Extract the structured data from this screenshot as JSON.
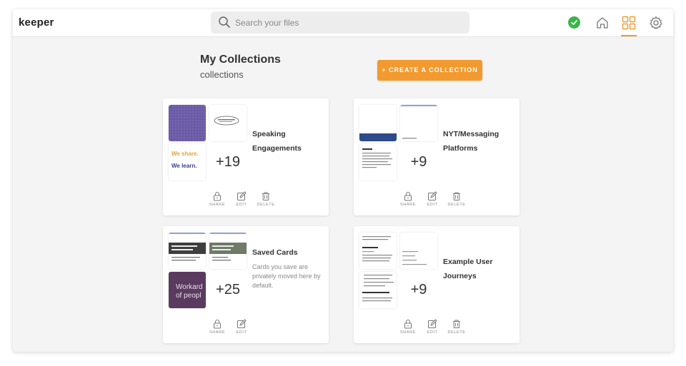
{
  "app": {
    "logo": "keeper"
  },
  "search": {
    "placeholder": "Search your files"
  },
  "header": {
    "title": "My Collections",
    "subtitle": "collections",
    "create_label": "+ CREATE A COLLECTION"
  },
  "colors": {
    "accent": "#f29a2e",
    "success": "#3bb44a",
    "background": "#f4f4f4"
  },
  "actions": {
    "share": "SHARE",
    "edit": "EDIT",
    "delete": "DELETE"
  },
  "collections": [
    {
      "title_line1": "Speaking",
      "title_line2": "Engagements",
      "count": "+19",
      "thumb_text_1": "We share.",
      "thumb_text_2": "We learn."
    },
    {
      "title_line1": "NYT/Messaging",
      "title_line2": "Platforms",
      "count": "+9"
    },
    {
      "title_line1": "Saved Cards",
      "title_line2": "",
      "count": "+25",
      "description": "Cards you save are privately moved here by default.",
      "thumb_text_1": "Workard of peopl"
    },
    {
      "title_line1": "Example User",
      "title_line2": "Journeys",
      "count": "+9"
    }
  ],
  "icons": [
    "search-icon",
    "check-circle-icon",
    "home-icon",
    "grid-icon",
    "gear-icon",
    "share-icon",
    "edit-icon",
    "delete-icon"
  ]
}
